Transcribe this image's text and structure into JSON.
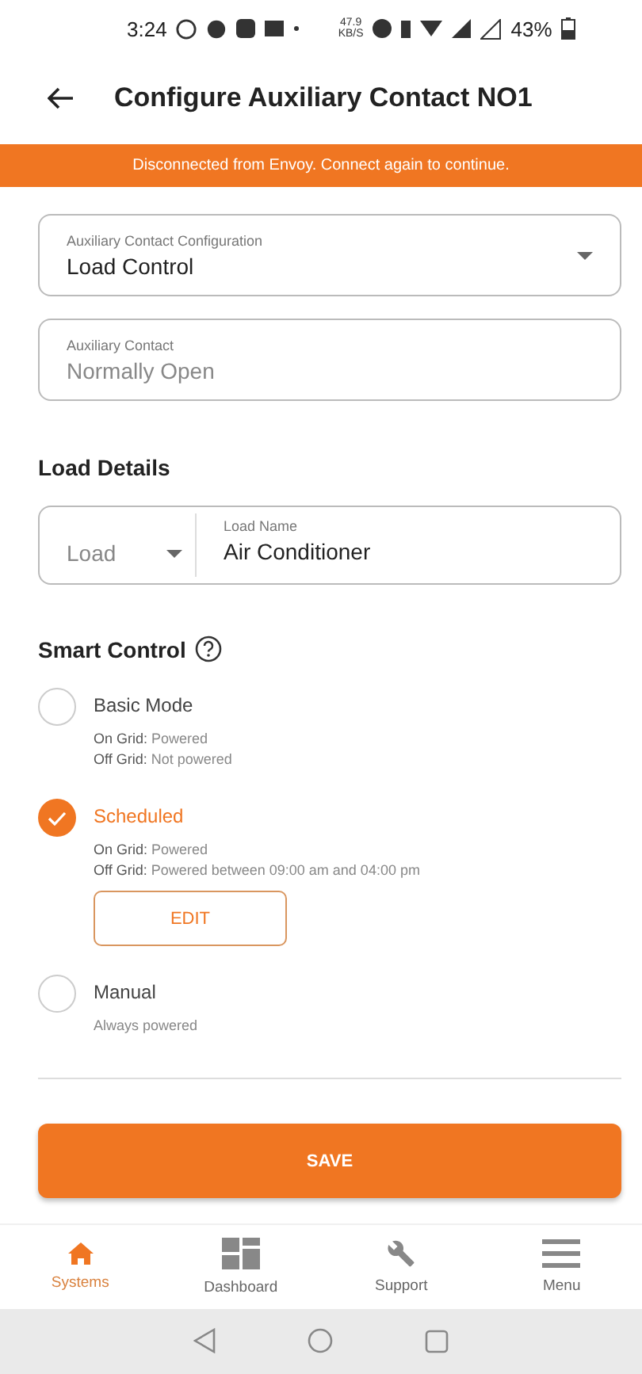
{
  "status_bar": {
    "time": "3:24",
    "speed": "47.9",
    "speed_unit": "KB/S",
    "battery": "43%"
  },
  "header": {
    "title": "Configure Auxiliary Contact NO1"
  },
  "banner": {
    "text": "Disconnected from Envoy. Connect again to continue."
  },
  "configuration_field": {
    "label": "Auxiliary Contact Configuration",
    "value": "Load Control"
  },
  "contact_field": {
    "label": "Auxiliary Contact",
    "value": "Normally Open",
    "disabled": true
  },
  "load_details": {
    "heading": "Load Details",
    "load_type": {
      "placeholder": "Load"
    },
    "load_name": {
      "label": "Load Name",
      "value": "Air Conditioner"
    }
  },
  "smart_control": {
    "heading": "Smart Control",
    "options": [
      {
        "label": "Basic Mode",
        "selected": false,
        "lines": [
          "**On Grid:** Powered",
          "**Off Grid:** Not powered"
        ]
      },
      {
        "label": "Scheduled",
        "selected": true,
        "lines": [
          "**On Grid:** Powered",
          "**Off Grid:** Powered between 09:00 am and 04:00 pm"
        ],
        "button": "EDIT"
      },
      {
        "label": "Manual",
        "selected": false,
        "lines": [
          "Always powered"
        ]
      }
    ]
  },
  "save_button": "SAVE",
  "bottom_nav": [
    {
      "label": "Systems",
      "kind": "home",
      "selected": true
    },
    {
      "label": "Dashboard",
      "kind": "dashboard",
      "selected": false
    },
    {
      "label": "Support",
      "kind": "wrench",
      "selected": false
    },
    {
      "label": "Menu",
      "kind": "menu",
      "selected": false
    }
  ]
}
